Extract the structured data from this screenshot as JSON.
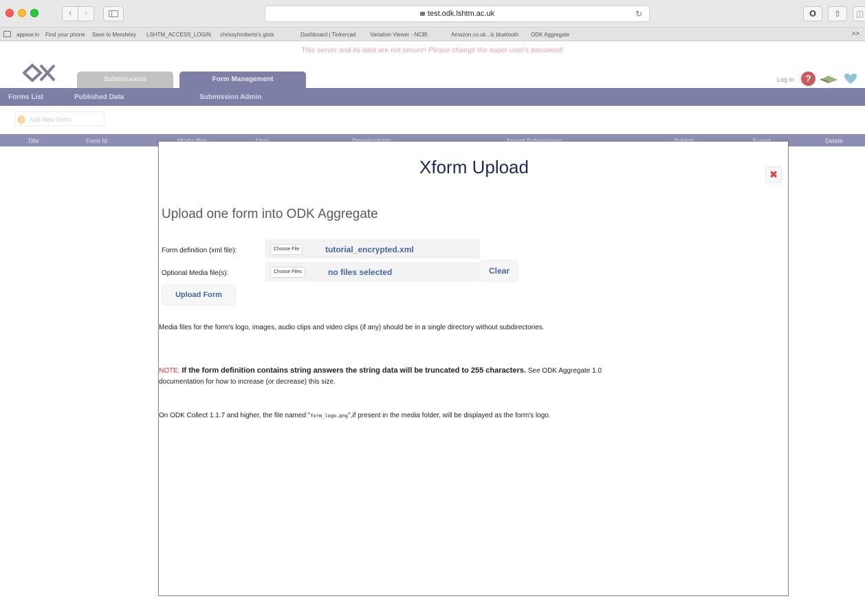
{
  "browser": {
    "url": "test.odk.lshtm.ac.uk",
    "bookmarks": [
      "appear.in",
      "Find your phone",
      "Save to Mendeley",
      "LSHTM_ACCESS_LOGIN",
      "chrissyhroberts's gists",
      "Dashboard | Tinkercad",
      "Variation Viewer - NCBI",
      "Amazon.co.uk...ic bluetooth",
      "ODK Aggregate"
    ],
    "more": ">>"
  },
  "warning": "This server and its data are not secure! Please change the super-user's password!",
  "tabs": {
    "submissions": "Submissions",
    "form_management": "Form Management"
  },
  "header": {
    "login": "Log In"
  },
  "subnav": [
    "Forms List",
    "Published Data",
    "Submission Admin"
  ],
  "add_form": "Add New Form",
  "table_columns": [
    "Title",
    "Form Id",
    "Media files",
    "User",
    "Downloadable",
    "Accept Submissions",
    "Publish",
    "Export",
    "Delete"
  ],
  "modal": {
    "title": "Xform Upload",
    "subtitle": "Upload one form into ODK Aggregate",
    "form_def_label": "Form definition (xml file):",
    "choose_file": "Choose File",
    "form_def_value": "tutorial_encrypted.xml",
    "media_label": "Optional Media file(s):",
    "choose_files": "Choose Files",
    "media_value": "no files selected",
    "clear": "Clear",
    "upload": "Upload Form",
    "media_note": "Media files for the form's logo, images, audio clips and video clips (if any) should be in a single directory without subdirectories.",
    "note_label": "NOTE:",
    "note_bold": "If the form definition contains string answers the string data will be truncated to 255 characters.",
    "note_rest": "See ODK Aggregate 1.0",
    "note_line2": "documentation for how to increase (or decrease) this size.",
    "logo_pre": "On ODK Collect 1.1.7 and higher, the file named \"",
    "logo_file": "form_logo.png",
    "logo_post": "\",if present in the media folder, will be displayed as the form's logo.",
    "close": "✖"
  }
}
